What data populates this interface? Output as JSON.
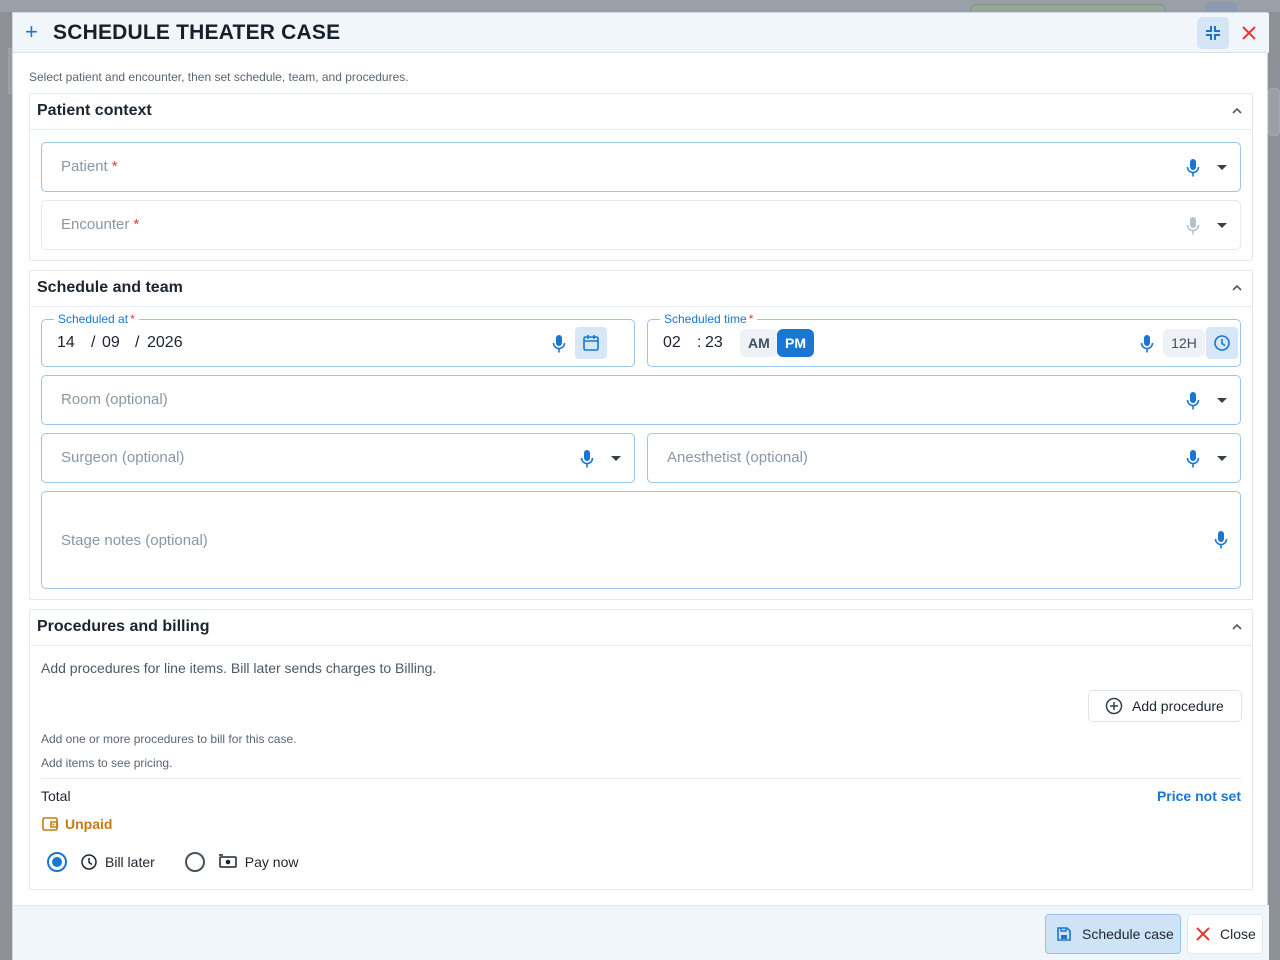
{
  "dialog": {
    "title": "SCHEDULE THEATER CASE",
    "subtitle": "Select patient and encounter, then set schedule, team, and procedures."
  },
  "sections": {
    "patient_context": {
      "title": "Patient context",
      "patient_placeholder": "Patient",
      "encounter_placeholder": "Encounter",
      "required_mark": "*"
    },
    "schedule_team": {
      "title": "Schedule and team",
      "scheduled_at_label": "Scheduled at",
      "date_day": "14",
      "date_month": "09",
      "date_year": "2026",
      "date_sep": "/",
      "scheduled_time_label": "Scheduled time",
      "time_hour": "02",
      "time_minute": "23",
      "time_sep": ":",
      "am_label": "AM",
      "pm_label": "PM",
      "format_label": "12H",
      "room_placeholder": "Room",
      "surgeon_placeholder": "Surgeon",
      "anesthetist_placeholder": "Anesthetist",
      "notes_placeholder": "Stage notes",
      "optional_suffix": "(optional)",
      "required_mark": "*"
    },
    "procedures_billing": {
      "title": "Procedures and billing",
      "info": "Add procedures for line items. Bill later sends charges to Billing.",
      "add_procedure_label": "Add procedure",
      "hint_procedures": "Add one or more procedures to bill for this case.",
      "hint_pricing": "Add items to see pricing.",
      "total_label": "Total",
      "price_status": "Price not set",
      "payment_status": "Unpaid",
      "option_bill_later": "Bill later",
      "option_pay_now": "Pay now",
      "selected_option": "Bill later"
    }
  },
  "footer": {
    "schedule_label": "Schedule case",
    "close_label": "Close"
  },
  "colors": {
    "accent": "#1976d2",
    "danger": "#e53935",
    "warning": "#c87a12",
    "header_bg": "#f1f6fb"
  },
  "icons": [
    "plus-icon",
    "collapse-icon",
    "close-icon",
    "chevron-up-icon",
    "mic-icon",
    "dropdown-arrow-icon",
    "calendar-icon",
    "clock-icon",
    "add-circle-icon",
    "wallet-icon",
    "cash-icon",
    "save-icon"
  ]
}
